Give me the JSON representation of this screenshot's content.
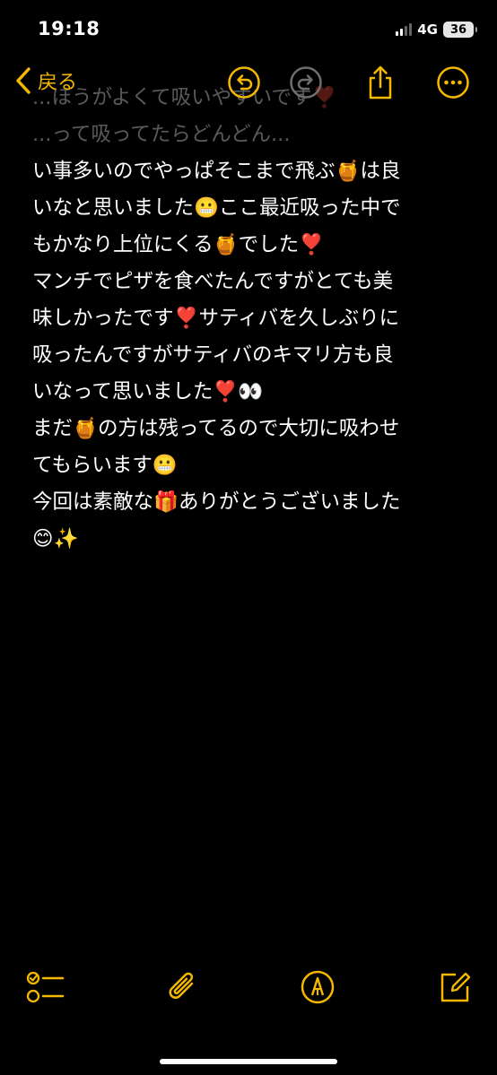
{
  "status_bar": {
    "time": "19:18",
    "network": "4G",
    "battery": "36"
  },
  "nav": {
    "back_label": "戻る"
  },
  "note": {
    "partial_lines": [
      "...ほうがよくて吸いやすいです❣️",
      "...って吸ってたらどんどん..."
    ],
    "lines": [
      "い事多いのでやっぱそこまで飛ぶ🍯は良",
      "いなと思いました😬ここ最近吸った中で",
      "もかなり上位にくる🍯でした❣️",
      "マンチでピザを食べたんですがとても美",
      "味しかったです❣️サティバを久しぶりに",
      "吸ったんですがサティバのキマリ方も良",
      "いなって思いました❣️👀",
      "まだ🍯の方は残ってるので大切に吸わせ",
      "てもらいます😬",
      "今回は素敵な🎁ありがとうございました",
      "😊✨"
    ]
  },
  "colors": {
    "accent": "#f5b800",
    "background": "#000000",
    "text": "#ffffff"
  },
  "icons": {
    "back": "chevron-left-icon",
    "undo": "undo-icon",
    "redo": "redo-icon",
    "share": "share-icon",
    "more": "more-icon",
    "checklist": "checklist-icon",
    "attachment": "paperclip-icon",
    "markup": "pen-circle-icon",
    "compose": "compose-icon"
  }
}
